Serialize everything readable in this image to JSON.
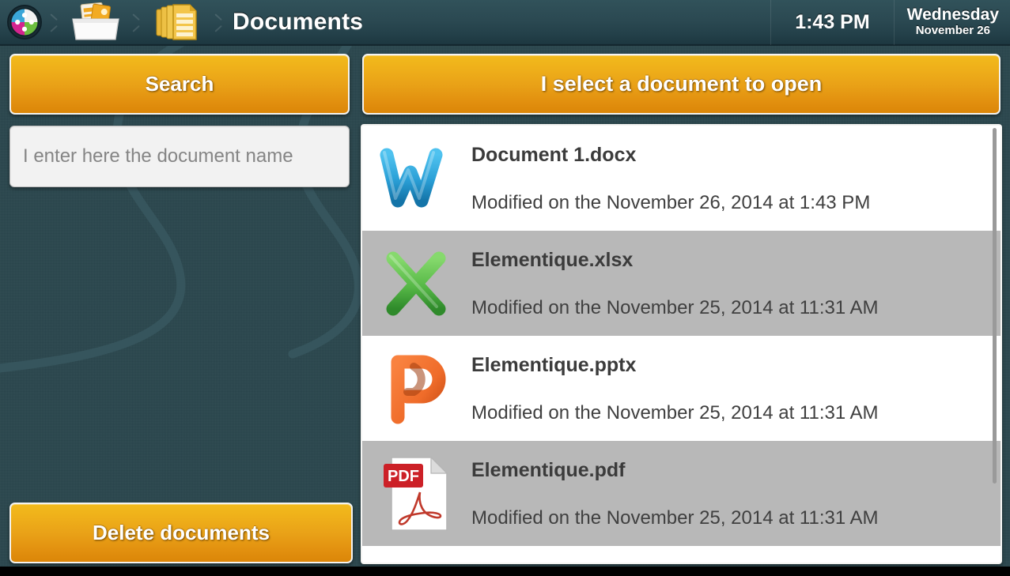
{
  "header": {
    "breadcrumb": [
      {
        "icon": "app-puzzle-logo-icon",
        "label": "Elementique"
      },
      {
        "icon": "folder-documents-icon",
        "label": "Documents folder"
      },
      {
        "icon": "stacked-pages-icon",
        "label": "Documents"
      }
    ],
    "title": "Documents",
    "clock": {
      "time": "1:43 PM",
      "weekday": "Wednesday",
      "monthday": "November 26"
    }
  },
  "left_panel": {
    "search_button_label": "Search",
    "search_input_placeholder": "I enter here the document name",
    "search_input_value": "",
    "delete_button_label": "Delete documents"
  },
  "right_panel": {
    "open_button_label": "I select a document to open",
    "documents": [
      {
        "name": "Document 1.docx",
        "modified": "Modified on the November 26, 2014 at  1:43 PM",
        "icon": "word-docx-icon",
        "row_style": "odd"
      },
      {
        "name": "Elementique.xlsx",
        "modified": "Modified on the November 25, 2014 at  11:31 AM",
        "icon": "excel-xlsx-icon",
        "row_style": "even"
      },
      {
        "name": "Elementique.pptx",
        "modified": "Modified on the November 25, 2014 at  11:31 AM",
        "icon": "powerpoint-pptx-icon",
        "row_style": "odd"
      },
      {
        "name": "Elementique.pdf",
        "modified": "Modified on the November 25, 2014 at  11:31 AM",
        "icon": "pdf-icon",
        "row_style": "even"
      }
    ]
  },
  "colors": {
    "background_teal": "#2a464d",
    "topbar_teal": "#2b4952",
    "button_gold_top": "#f2bb1c",
    "button_gold_bottom": "#db8608",
    "row_alt_gray": "#b8b8b8",
    "word_blue": "#2a9fd6",
    "excel_green": "#57b947",
    "powerpoint_orange": "#ef6c2a",
    "pdf_red": "#cc2027"
  }
}
